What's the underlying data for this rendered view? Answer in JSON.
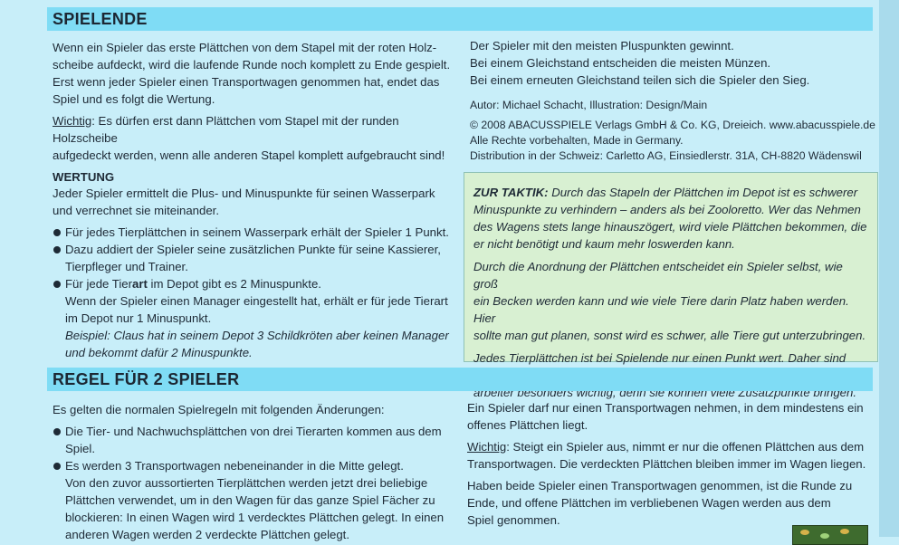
{
  "spielende": {
    "title": "SPIELENDE",
    "p1": "Wenn ein Spieler das erste Plättchen von dem Stapel mit der roten Holz-scheibe aufdeckt, wird die laufende Runde noch komplett zu Ende gespielt. Erst wenn jeder Spieler einen Transportwagen genommen hat, endet das Spiel und es folgt die Wertung.",
    "p1_lines": [
      "Wenn ein Spieler das erste Plättchen von dem Stapel mit der roten Holz-",
      "scheibe aufdeckt, wird die laufende Runde noch komplett zu Ende gespielt.",
      "Erst wenn jeder Spieler einen Transportwagen genommen hat, endet das",
      "Spiel und es folgt die Wertung."
    ],
    "wichtig_label": "Wichtig",
    "wichtig_lines": [
      ": Es dürfen erst dann Plättchen vom Stapel mit der runden Holzscheibe",
      "aufgedeckt werden, wenn alle anderen Stapel komplett aufgebraucht sind!"
    ],
    "wertung_heading": "WERTUNG",
    "wertung_lines": [
      "Jeder Spieler ermittelt die Plus- und Minuspunkte für seinen Wasserpark",
      "und verrechnet sie miteinander."
    ],
    "bullet1": "Für jedes Tierplättchen in seinem Wasserpark erhält der Spieler 1 Punkt.",
    "bullet2_lines": [
      "Dazu addiert der Spieler seine zusätzlichen Punkte für seine Kassierer,",
      "Tierpfleger und Trainer."
    ],
    "bullet3_pre": "Für jede Tier",
    "bullet3_bold": "art",
    "bullet3_post": " im Depot gibt es 2 Minuspunkte.",
    "manager_lines": [
      "Wenn der Spieler einen Manager eingestellt hat, erhält er für jede Tierart",
      "im Depot nur 1 Minuspunkt."
    ],
    "beispiel_lines": [
      "Beispiel: Claus hat in seinem Depot 3 Schildkröten aber keinen Manager",
      "und bekommt dafür 2 Minuspunkte."
    ],
    "right_lines": [
      "Der Spieler mit den meisten Pluspunkten gewinnt.",
      "Bei einem Gleichstand entscheiden die meisten Münzen.",
      "Bei einem erneuten Gleichstand teilen sich die Spieler den Sieg."
    ],
    "autor": "Autor: Michael Schacht, Illustration: Design/Main",
    "copyright_lines": [
      "© 2008 ABACUSSPIELE Verlags GmbH & Co. KG, Dreieich. www.abacusspiele.de",
      "Alle Rechte vorbehalten, Made in Germany.",
      "Distribution in der Schweiz: Carletto AG, Einsiedlerstr. 31A, CH-8820 Wädenswil"
    ]
  },
  "taktik": {
    "label": "ZUR TAKTIK:",
    "p1_rest": " Durch das Stapeln der Plättchen im Depot ist es schwerer",
    "p1_lines": [
      "Minuspunkte zu verhindern – anders als bei Zooloretto. Wer das Nehmen",
      "des Wagens stets lange hinauszögert, wird viele Plättchen bekommen, die",
      "er nicht benötigt und kaum mehr loswerden kann."
    ],
    "p2_lines": [
      "Durch die Anordnung der Plättchen entscheidet ein Spieler selbst, wie groß",
      "ein Becken werden kann und wie viele Tiere darin Platz haben werden. Hier",
      "sollte man gut planen, sonst wird es schwer, alle Tiere gut unterzubringen."
    ],
    "p3_lines": [
      "Jedes Tierplättchen ist bei Spielende nur einen Punkt wert. Daher sind Mit-",
      "arbeiter besonders wichtig, denn sie können viele Zusatzpunkte bringen."
    ]
  },
  "zwei": {
    "title": "REGEL FÜR 2 SPIELER",
    "intro": "Es gelten die normalen Spielregeln mit folgenden Änderungen:",
    "bullet1": "Die Tier- und Nachwuchsplättchen von drei Tierarten kommen aus dem Spiel.",
    "bullet2": "Es werden 3 Transportwagen nebeneinander in die Mitte gelegt.",
    "bullet2_more": [
      "Von den zuvor aussortierten Tierplättchen werden jetzt drei beliebige",
      "Plättchen verwendet, um in den Wagen für das ganze Spiel Fächer zu",
      "blockieren: In einen Wagen wird 1 verdecktes Plättchen gelegt. In einen",
      "anderen Wagen werden 2 verdeckte Plättchen gelegt."
    ],
    "right_p1": [
      "Ein Spieler darf nur einen Transportwagen nehmen, in dem mindestens ein",
      "offenes Plättchen liegt."
    ],
    "wichtig_label": "Wichtig",
    "wichtig_lines": [
      ": Steigt ein Spieler aus, nimmt er nur die offenen Plättchen aus dem",
      "Transportwagen. Die verdeckten Plättchen bleiben immer im Wagen liegen."
    ],
    "right_p3": [
      "Haben beide Spieler einen Transportwagen genommen, ist die Runde zu",
      "Ende, und offene Plättchen im verbliebenen Wagen werden aus dem",
      "Spiel genommen."
    ]
  }
}
